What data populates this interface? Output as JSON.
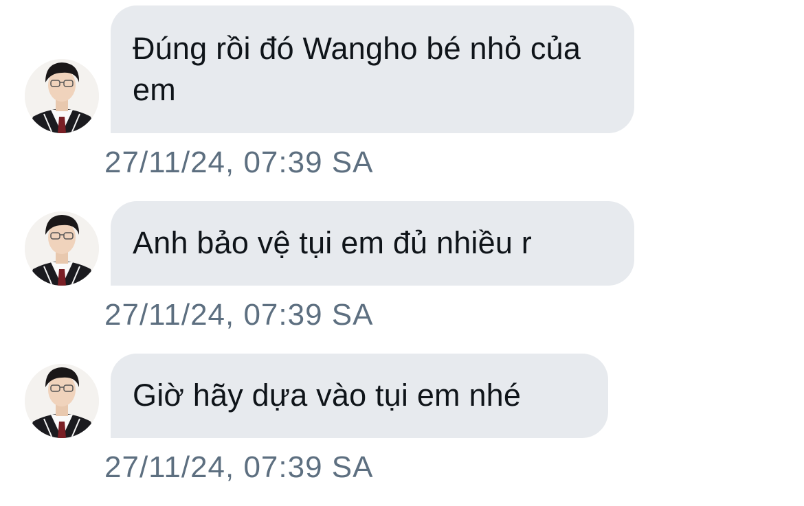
{
  "conversation": {
    "messages": [
      {
        "text": "Đúng rồi đó Wangho bé nhỏ của em",
        "timestamp": "27/11/24, 07:39 SA",
        "avatar": "user-avatar"
      },
      {
        "text": "Anh bảo vệ tụi em đủ nhiều r",
        "timestamp": "27/11/24, 07:39 SA",
        "avatar": "user-avatar"
      },
      {
        "text": "Giờ hãy dựa vào tụi em nhé",
        "timestamp": "27/11/24, 07:39 SA",
        "avatar": "user-avatar"
      }
    ]
  },
  "colors": {
    "bubble_bg": "#e7eaee",
    "message_text": "#0f1419",
    "timestamp_text": "#5d6f80",
    "background": "#ffffff"
  }
}
